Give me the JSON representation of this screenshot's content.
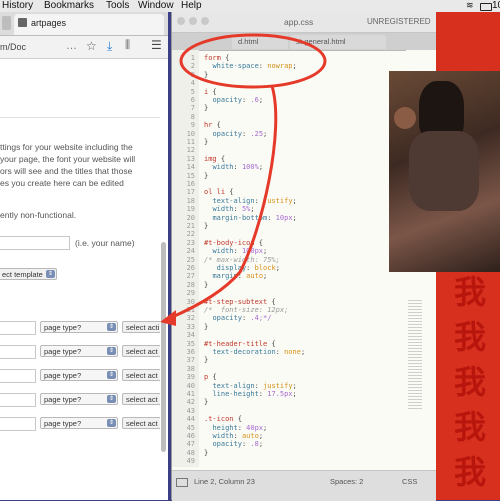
{
  "menubar": {
    "items": [
      "History",
      "Bookmarks",
      "Tools",
      "Window",
      "Help"
    ],
    "battery": "10"
  },
  "browser": {
    "tab_title": "artpages",
    "url": "m/Doc",
    "intro_lines": [
      "ttings for your website including the",
      "your page, the font your website will",
      "ors will see and the titles that those",
      "es you create here can be edited"
    ],
    "nonfunctional": "ently non-functional.",
    "name_hint": "(i.e. your name)",
    "select_template": "ect template",
    "rows": [
      {
        "page_type": "page type?",
        "select_action": "select acti"
      },
      {
        "page_type": "page type?",
        "select_action": "select act"
      },
      {
        "page_type": "page type?",
        "select_action": "select act"
      },
      {
        "page_type": "page type?",
        "select_action": "select act"
      },
      {
        "page_type": "page type?",
        "select_action": "select act"
      }
    ]
  },
  "editor": {
    "title": "app.css",
    "unregistered": "UNREGISTERED",
    "tabs": [
      "",
      "d.html",
      "st-general.html"
    ],
    "status": {
      "position": "Line 2, Column 23",
      "spaces": "Spaces: 2",
      "syntax": "CSS"
    },
    "lines": [
      {
        "n": "1",
        "t": "form {"
      },
      {
        "n": "2",
        "t": "  white-space: nowrap;"
      },
      {
        "n": "3",
        "t": "}"
      },
      {
        "n": "4",
        "t": ""
      },
      {
        "n": "5",
        "t": "i {"
      },
      {
        "n": "6",
        "t": "  opacity: .6;"
      },
      {
        "n": "7",
        "t": "}"
      },
      {
        "n": "8",
        "t": ""
      },
      {
        "n": "9",
        "t": "hr {"
      },
      {
        "n": "10",
        "t": "  opacity: .25;"
      },
      {
        "n": "11",
        "t": "}"
      },
      {
        "n": "12",
        "t": ""
      },
      {
        "n": "13",
        "t": "img {"
      },
      {
        "n": "14",
        "t": "  width: 100%;"
      },
      {
        "n": "15",
        "t": "}"
      },
      {
        "n": "16",
        "t": ""
      },
      {
        "n": "17",
        "t": "ol li {"
      },
      {
        "n": "18",
        "t": "  text-align: justify;"
      },
      {
        "n": "19",
        "t": "  width: 5%;"
      },
      {
        "n": "20",
        "t": "  margin-bottom: 10px;"
      },
      {
        "n": "21",
        "t": "}"
      },
      {
        "n": "22",
        "t": ""
      },
      {
        "n": "23",
        "t": "#t-body-icon {"
      },
      {
        "n": "24",
        "t": "  width: 100px;"
      },
      {
        "n": "25",
        "t": "/* max-width: 75%;"
      },
      {
        "n": "26",
        "t": "   display: block;"
      },
      {
        "n": "27",
        "t": "  margin: auto;"
      },
      {
        "n": "28",
        "t": "}"
      },
      {
        "n": "29",
        "t": ""
      },
      {
        "n": "30",
        "t": "#t-step-subtext {"
      },
      {
        "n": "31",
        "t": "/*  font-size: 12px;"
      },
      {
        "n": "32",
        "t": "  opacity: .4;*/"
      },
      {
        "n": "33",
        "t": "}"
      },
      {
        "n": "34",
        "t": ""
      },
      {
        "n": "35",
        "t": "#t-header-title {"
      },
      {
        "n": "36",
        "t": "  text-decoration: none;"
      },
      {
        "n": "37",
        "t": "}"
      },
      {
        "n": "38",
        "t": ""
      },
      {
        "n": "39",
        "t": "p {"
      },
      {
        "n": "40",
        "t": "  text-align: justify;"
      },
      {
        "n": "41",
        "t": "  line-height: 17.5px;"
      },
      {
        "n": "42",
        "t": "}"
      },
      {
        "n": "43",
        "t": ""
      },
      {
        "n": "44",
        "t": ".t-icon {"
      },
      {
        "n": "45",
        "t": "  height: 40px;"
      },
      {
        "n": "46",
        "t": "  width: auto;"
      },
      {
        "n": "47",
        "t": "  opacity: .8;"
      },
      {
        "n": "48",
        "t": "}"
      },
      {
        "n": "49",
        "t": ""
      }
    ]
  },
  "desktop": {
    "glyph": "我"
  },
  "colors": {
    "annotation": "#e53a2a",
    "desktop_red": "#d8301f"
  }
}
